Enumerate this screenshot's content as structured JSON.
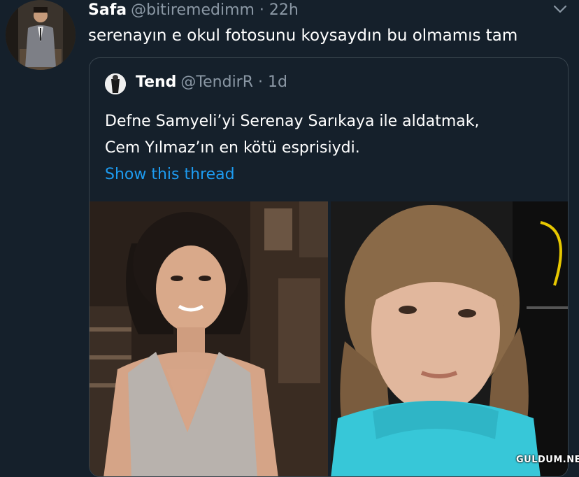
{
  "tweet": {
    "display_name": "Safa",
    "handle_time": "@bitiremedimm · 22h",
    "text": "serenayın e okul fotosunu koysaydın bu olmamıs tam"
  },
  "quoted_tweet": {
    "display_name": "Tend",
    "handle_time": "@TendirR · 1d",
    "text_lines": [
      "Defne Samyeli’yi Serenay Sarıkaya ile aldatmak,",
      "Cem Yılmaz’ın en kötü esprisiydi."
    ],
    "show_thread_label": "Show this thread"
  },
  "watermark": "GULDUM.NET",
  "icons": {
    "menu": "chevron-down-icon"
  },
  "colors": {
    "background": "#15202b",
    "link": "#1d9bf0",
    "secondary_text": "#8b98a5",
    "border": "#38444d"
  }
}
